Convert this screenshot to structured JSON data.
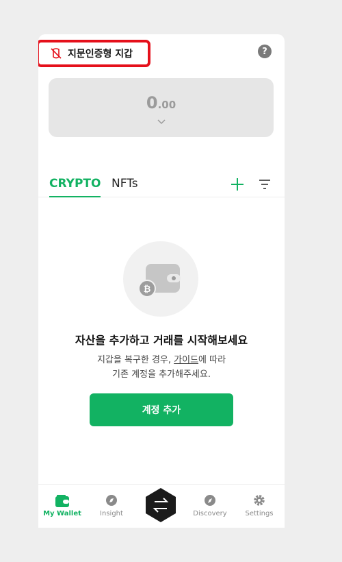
{
  "header": {
    "wallet_type_label": "지문인증형 지갑",
    "help_symbol": "?"
  },
  "balance": {
    "integer": "0",
    "decimal": ".00"
  },
  "tabs": [
    {
      "label": "CRYPTO",
      "active": true
    },
    {
      "label": "NFTs",
      "active": false
    }
  ],
  "empty_state": {
    "title": "자산을 추가하고 거래를 시작해보세요",
    "desc_line1_prefix": "지갑을 복구한 경우, ",
    "desc_line1_link": "가이드",
    "desc_line1_suffix": "에 따라",
    "desc_line2": "기존 계정을 추가해주세요.",
    "button_label": "계정 추가"
  },
  "bottom_nav": {
    "wallet": "My Wallet",
    "insight": "Insight",
    "discovery": "Discovery",
    "settings": "Settings"
  },
  "colors": {
    "accent": "#12b262",
    "highlight": "#e5101b"
  },
  "icons": [
    "fingerprint-icon",
    "help-icon",
    "chevron-down-icon",
    "plus-icon",
    "filter-icon",
    "wallet-icon",
    "bitcoin-icon",
    "compass-icon",
    "swap-icon",
    "gear-icon"
  ]
}
